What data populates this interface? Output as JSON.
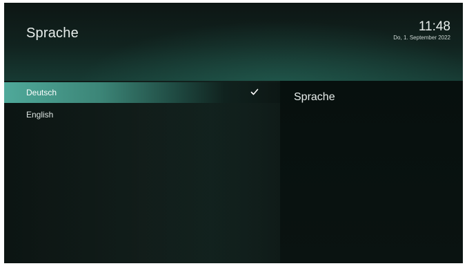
{
  "header": {
    "title": "Sprache",
    "time": "11:48",
    "date": "Do, 1. September 2022"
  },
  "language_list": {
    "items": [
      {
        "label": "Deutsch",
        "selected": true,
        "checked": true
      },
      {
        "label": "English",
        "selected": false,
        "checked": false
      }
    ]
  },
  "detail_panel": {
    "title": "Sprache"
  },
  "icons": {
    "check": "check-icon"
  },
  "colors": {
    "accent": "#4fa99a",
    "background": "#0b1210",
    "text": "#e8eeec"
  }
}
